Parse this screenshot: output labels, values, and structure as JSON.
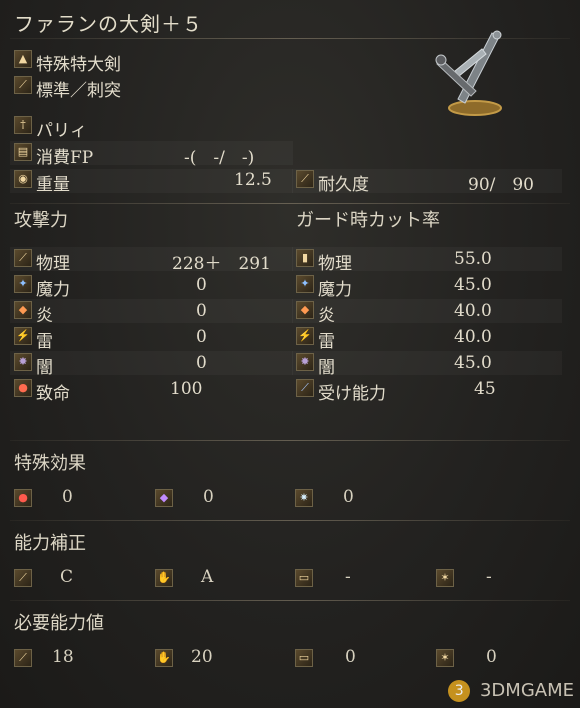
{
  "weapon": {
    "name": "ファランの大剣＋５",
    "type": "特殊特大剣",
    "attack_type": "標準／刺突",
    "skill": "パリィ",
    "fp_label": "消費FP",
    "fp_value": "-(　-/　-)",
    "weight_label": "重量",
    "weight_value": "12.5",
    "durability_label": "耐久度",
    "durability_value": "90/　90"
  },
  "attack": {
    "title": "攻撃力",
    "rows": [
      {
        "label": "物理",
        "value": "228＋　291",
        "icon": "sword-icon"
      },
      {
        "label": "魔力",
        "value": "0",
        "icon": "magic-icon"
      },
      {
        "label": "炎",
        "value": "0",
        "icon": "fire-icon"
      },
      {
        "label": "雷",
        "value": "0",
        "icon": "lightning-icon"
      },
      {
        "label": "闇",
        "value": "0",
        "icon": "dark-icon"
      },
      {
        "label": "致命",
        "value": "100",
        "icon": "critical-icon"
      }
    ]
  },
  "guard": {
    "title": "ガード時カット率",
    "rows": [
      {
        "label": "物理",
        "value": "55.0",
        "icon": "shield-icon"
      },
      {
        "label": "魔力",
        "value": "45.0",
        "icon": "magic-shield-icon"
      },
      {
        "label": "炎",
        "value": "40.0",
        "icon": "fire-shield-icon"
      },
      {
        "label": "雷",
        "value": "40.0",
        "icon": "lightning-shield-icon"
      },
      {
        "label": "闇",
        "value": "45.0",
        "icon": "dark-shield-icon"
      },
      {
        "label": "受け能力",
        "value": "45",
        "icon": "stability-icon"
      }
    ]
  },
  "special": {
    "title": "特殊効果",
    "items": [
      "0",
      "0",
      "0"
    ]
  },
  "scaling": {
    "title": "能力補正",
    "items": [
      "C",
      "A",
      "-",
      "-"
    ]
  },
  "requirements": {
    "title": "必要能力値",
    "items": [
      "18",
      "20",
      "0",
      "0"
    ]
  },
  "watermark": "3DMGAME"
}
